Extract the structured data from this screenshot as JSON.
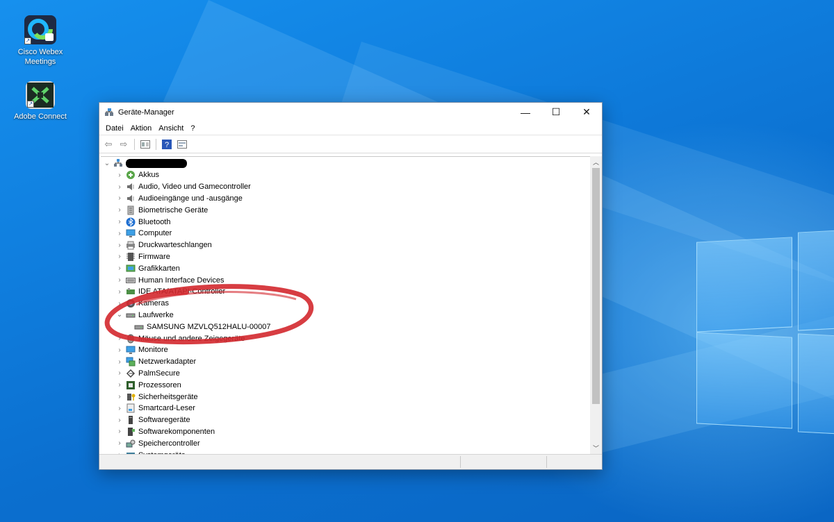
{
  "desktop": {
    "icons": [
      {
        "label": "Cisco Webex Meetings"
      },
      {
        "label": "Adobe Connect"
      }
    ]
  },
  "window": {
    "title": "Geräte-Manager",
    "controls": {
      "minimize": "—",
      "maximize": "☐",
      "close": "✕"
    },
    "menu": [
      "Datei",
      "Aktion",
      "Ansicht",
      "?"
    ],
    "tree": {
      "root_label": "",
      "items": [
        {
          "label": "Akkus",
          "icon": "battery-icon",
          "expanded": false
        },
        {
          "label": "Audio, Video und Gamecontroller",
          "icon": "speaker-icon",
          "expanded": false
        },
        {
          "label": "Audioeingänge und -ausgänge",
          "icon": "speaker-icon",
          "expanded": false
        },
        {
          "label": "Biometrische Geräte",
          "icon": "fingerprint-icon",
          "expanded": false
        },
        {
          "label": "Bluetooth",
          "icon": "bluetooth-icon",
          "expanded": false
        },
        {
          "label": "Computer",
          "icon": "monitor-icon",
          "expanded": false
        },
        {
          "label": "Druckwarteschlangen",
          "icon": "printer-icon",
          "expanded": false
        },
        {
          "label": "Firmware",
          "icon": "chip-icon",
          "expanded": false
        },
        {
          "label": "Grafikkarten",
          "icon": "display-adapter-icon",
          "expanded": false
        },
        {
          "label": "Human Interface Devices",
          "icon": "keyboard-icon",
          "expanded": false
        },
        {
          "label": "IDE ATA/ATAPI-Controller",
          "icon": "ide-controller-icon",
          "expanded": false
        },
        {
          "label": "Kameras",
          "icon": "camera-icon",
          "expanded": false
        },
        {
          "label": "Laufwerke",
          "icon": "drive-icon",
          "expanded": true
        },
        {
          "label": "SAMSUNG MZVLQ512HALU-00007",
          "icon": "drive-icon",
          "child": true
        },
        {
          "label": "Mäuse und andere Zeigegeräte",
          "icon": "mouse-icon",
          "expanded": false
        },
        {
          "label": "Monitore",
          "icon": "monitor-icon",
          "expanded": false
        },
        {
          "label": "Netzwerkadapter",
          "icon": "network-icon",
          "expanded": false
        },
        {
          "label": "PalmSecure",
          "icon": "palm-icon",
          "expanded": false
        },
        {
          "label": "Prozessoren",
          "icon": "processor-icon",
          "expanded": false
        },
        {
          "label": "Sicherheitsgeräte",
          "icon": "security-key-icon",
          "expanded": false
        },
        {
          "label": "Smartcard-Leser",
          "icon": "smartcard-icon",
          "expanded": false
        },
        {
          "label": "Softwaregeräte",
          "icon": "software-device-icon",
          "expanded": false
        },
        {
          "label": "Softwarekomponenten",
          "icon": "component-icon",
          "expanded": false
        },
        {
          "label": "Speichercontroller",
          "icon": "storage-controller-icon",
          "expanded": false
        },
        {
          "label": "Systemgeräte",
          "icon": "system-device-icon",
          "expanded": false
        }
      ]
    }
  },
  "colors": {
    "annotation": "#d3282e",
    "desktop_blue": "#0f7ddd",
    "selection_redaction": "#000000"
  }
}
